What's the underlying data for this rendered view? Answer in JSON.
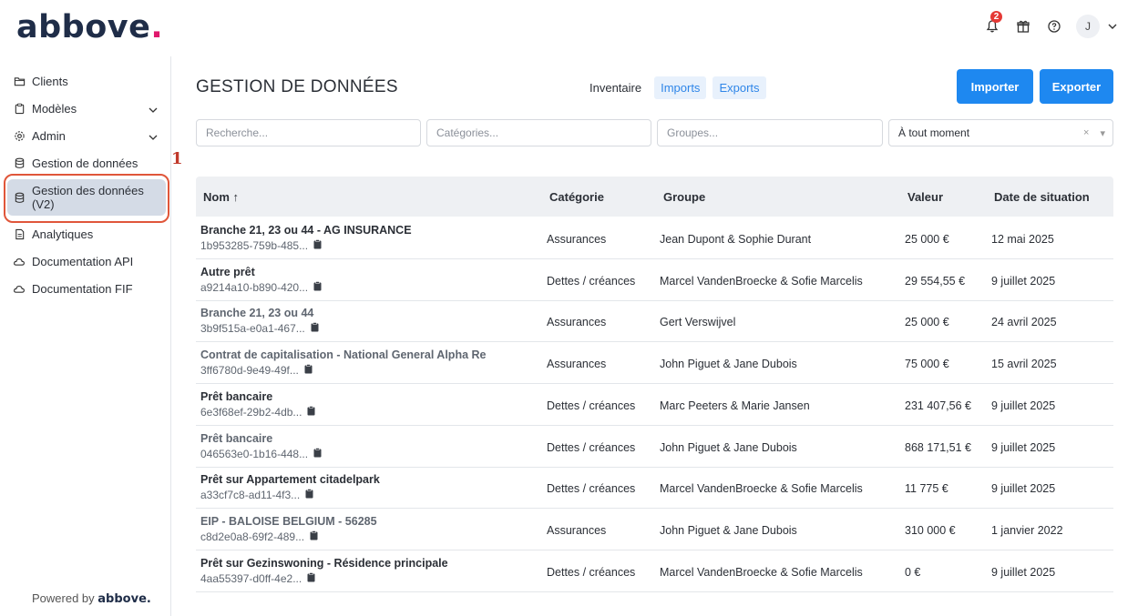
{
  "header": {
    "logo": "abbove",
    "logo_dot": ".",
    "notification_count": "2",
    "user_initial": "J"
  },
  "sidebar": {
    "items": [
      {
        "label": "Clients",
        "icon": "folder-icon"
      },
      {
        "label": "Modèles",
        "icon": "clipboard-icon"
      },
      {
        "label": "Admin",
        "icon": "gear-icon"
      },
      {
        "label": "Gestion de données",
        "icon": "database-icon"
      },
      {
        "label": "Gestion des données (V2)",
        "icon": "database-icon",
        "active": true
      },
      {
        "label": "Analytiques",
        "icon": "document-icon"
      },
      {
        "label": "Documentation API",
        "icon": "cloud-icon"
      },
      {
        "label": "Documentation FIF",
        "icon": "cloud-icon"
      }
    ],
    "annotation_marker": "1",
    "powered_prefix": "Powered by",
    "powered_brand": "abbove."
  },
  "main": {
    "title": "GESTION DE DONNÉES",
    "tabs": [
      "Inventaire",
      "Imports",
      "Exports"
    ],
    "import_button": "Importer",
    "export_button": "Exporter",
    "filters": {
      "search_placeholder": "Recherche...",
      "categories_placeholder": "Catégories...",
      "groups_placeholder": "Groupes...",
      "period_value": "À tout moment",
      "period_clear": "×",
      "period_caret": "▾"
    },
    "table": {
      "headers": [
        "Nom ↑",
        "Catégorie",
        "Groupe",
        "Valeur",
        "Date de situation"
      ],
      "rows": [
        {
          "name": "Branche 21, 23 ou 44 - AG INSURANCE",
          "id": "1b953285-759b-485...",
          "category": "Assurances",
          "group": "Jean Dupont & Sophie Durant",
          "value": "25 000 €",
          "date": "12 mai 2025",
          "muted": false
        },
        {
          "name": "Autre prêt",
          "id": "a9214a10-b890-420...",
          "category": "Dettes / créances",
          "group": "Marcel VandenBroecke & Sofie Marcelis",
          "value": "29 554,55 €",
          "date": "9 juillet 2025",
          "muted": false
        },
        {
          "name": "Branche 21, 23 ou 44",
          "id": "3b9f515a-e0a1-467...",
          "category": "Assurances",
          "group": "Gert Verswijvel",
          "value": "25 000 €",
          "date": "24 avril 2025",
          "muted": true
        },
        {
          "name": "Contrat de capitalisation - National General Alpha Re",
          "id": "3ff6780d-9e49-49f...",
          "category": "Assurances",
          "group": "John Piguet & Jane Dubois",
          "value": "75 000 €",
          "date": "15 avril 2025",
          "muted": true
        },
        {
          "name": "Prêt bancaire",
          "id": "6e3f68ef-29b2-4db...",
          "category": "Dettes / créances",
          "group": "Marc Peeters & Marie Jansen",
          "value": "231 407,56 €",
          "date": "9 juillet 2025",
          "muted": false
        },
        {
          "name": "Prêt bancaire",
          "id": "046563e0-1b16-448...",
          "category": "Dettes / créances",
          "group": "John Piguet & Jane Dubois",
          "value": "868 171,51 €",
          "date": "9 juillet 2025",
          "muted": true
        },
        {
          "name": "Prêt sur Appartement citadelpark",
          "id": "a33cf7c8-ad11-4f3...",
          "category": "Dettes / créances",
          "group": "Marcel VandenBroecke & Sofie Marcelis",
          "value": "11 775 €",
          "date": "9 juillet 2025",
          "muted": false
        },
        {
          "name": "EIP - BALOISE BELGIUM - 56285",
          "id": "c8d2e0a8-69f2-489...",
          "category": "Assurances",
          "group": "John Piguet & Jane Dubois",
          "value": "310 000 €",
          "date": "1 janvier 2022",
          "muted": true
        },
        {
          "name": "Prêt sur Gezinswoning - Résidence principale",
          "id": "4aa55397-d0ff-4e2...",
          "category": "Dettes / créances",
          "group": "Marcel VandenBroecke & Sofie Marcelis",
          "value": "0 €",
          "date": "9 juillet 2025",
          "muted": false
        }
      ]
    }
  }
}
